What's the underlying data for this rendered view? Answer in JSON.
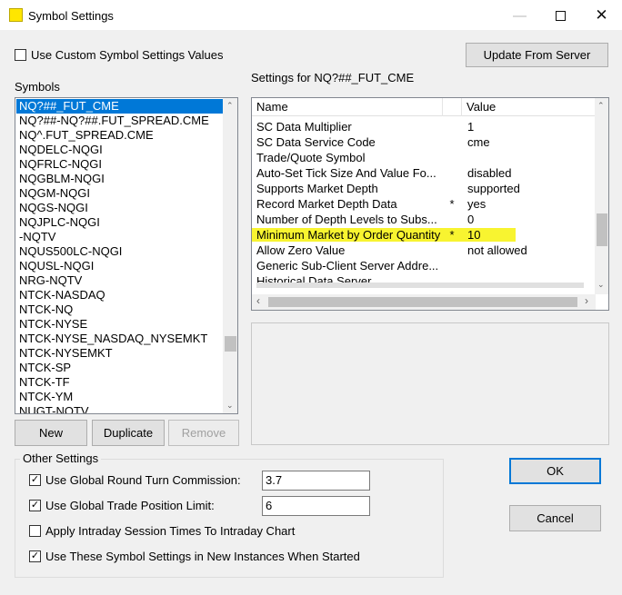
{
  "window": {
    "title": "Symbol Settings"
  },
  "top": {
    "use_custom_label": "Use Custom Symbol Settings Values",
    "use_custom_checked": false,
    "update_button": "Update From Server"
  },
  "symbols": {
    "label": "Symbols",
    "items": [
      "NQ?##_FUT_CME",
      "NQ?##-NQ?##.FUT_SPREAD.CME",
      "NQ^.FUT_SPREAD.CME",
      "NQDELC-NQGI",
      "NQFRLC-NQGI",
      "NQGBLM-NQGI",
      "NQGM-NQGI",
      "NQGS-NQGI",
      "NQJPLC-NQGI",
      "-NQTV",
      "NQUS500LC-NQGI",
      "NQUSL-NQGI",
      "NRG-NQTV",
      "NTCK-NASDAQ",
      "NTCK-NQ",
      "NTCK-NYSE",
      "NTCK-NYSE_NASDAQ_NYSEMKT",
      "NTCK-NYSEMKT",
      "NTCK-SP",
      "NTCK-TF",
      "NTCK-YM",
      "NUGT-NQTV"
    ],
    "selected_index": 0
  },
  "buttons": {
    "new": "New",
    "duplicate": "Duplicate",
    "remove": "Remove",
    "ok": "OK",
    "cancel": "Cancel"
  },
  "settings": {
    "label": "Settings for NQ?##_FUT_CME",
    "col_name": "Name",
    "col_value": "Value",
    "rows": [
      {
        "name": "SC Data Multiplier",
        "star": "",
        "value": "1",
        "highlight": false
      },
      {
        "name": "SC Data Service Code",
        "star": "",
        "value": "cme",
        "highlight": false
      },
      {
        "name": "Trade/Quote Symbol",
        "star": "",
        "value": "",
        "highlight": false
      },
      {
        "name": "Auto-Set Tick Size And Value Fo...",
        "star": "",
        "value": "disabled",
        "highlight": false
      },
      {
        "name": "Supports Market Depth",
        "star": "",
        "value": "supported",
        "highlight": false
      },
      {
        "name": "Record Market Depth Data",
        "star": "*",
        "value": "yes",
        "highlight": false
      },
      {
        "name": "Number of Depth Levels to Subs...",
        "star": "",
        "value": "0",
        "highlight": false
      },
      {
        "name": "Minimum Market by Order Quantity",
        "star": "*",
        "value": "10",
        "highlight": true
      },
      {
        "name": "Allow Zero Value",
        "star": "",
        "value": "not allowed",
        "highlight": false
      },
      {
        "name": "Generic Sub-Client Server Addre...",
        "star": "",
        "value": "",
        "highlight": false
      },
      {
        "name": "Historical Data Server",
        "star": "",
        "value": "",
        "highlight": false
      }
    ]
  },
  "other": {
    "title": "Other Settings",
    "round_turn_label": "Use Global Round Turn Commission:",
    "round_turn_checked": true,
    "round_turn_value": "3.7",
    "trade_limit_label": "Use Global Trade Position Limit:",
    "trade_limit_checked": true,
    "trade_limit_value": "6",
    "intraday_label": "Apply Intraday Session Times To Intraday Chart",
    "intraday_checked": false,
    "new_instances_label": "Use These Symbol Settings in New Instances When Started",
    "new_instances_checked": true
  },
  "colors": {
    "selection": "#0078d7",
    "highlight": "#f8f430",
    "accent": "#0078d7"
  }
}
